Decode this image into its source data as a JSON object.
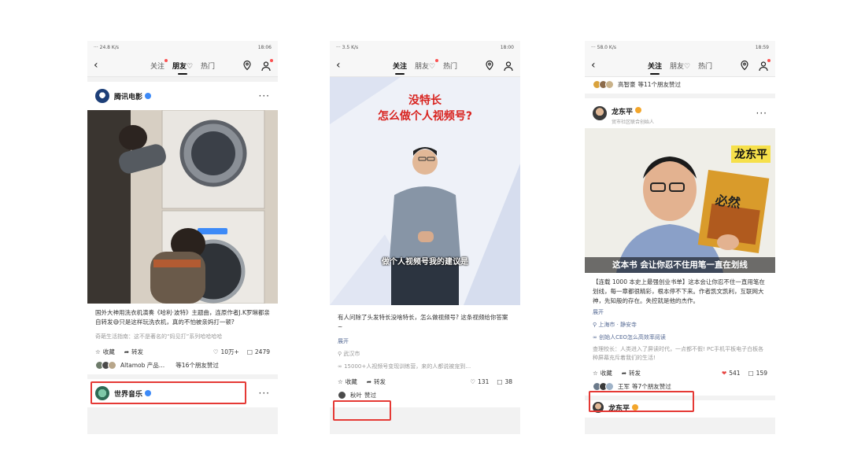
{
  "phones": [
    {
      "status": {
        "left": "··· 24.8 K/s",
        "right": "18:06"
      },
      "tabs": [
        "关注",
        "朋友♡",
        "热门"
      ],
      "active_tab": 1,
      "card": {
        "author": "腾讯电影",
        "text": "国外大神用洗衣机演奏《哈利·波特》主题曲，连原作者J.K罗琳都亲自转发😅只是这样玩洗衣机，真的不怕被亲妈打一顿?",
        "meta": "奇葩生活指南：这不是著名的“妈见打”系列哈哈哈哈",
        "actions": {
          "fav": "收藏",
          "share": "转发",
          "likes": "10万+",
          "comments": "2479"
        },
        "liked_by": {
          "names": "Altamob 产品…",
          "count": "等16个朋友赞过"
        }
      },
      "next_author": "世界音乐"
    },
    {
      "status": {
        "left": "··· 3.5 K/s",
        "right": "18:00"
      },
      "tabs": [
        "关注",
        "朋友♡",
        "热门"
      ],
      "active_tab": 0,
      "card": {
        "video_title_line1": "没特长",
        "video_title_line2": "怎么做个人视频号?",
        "video_caption": "做个人视频号我的建议是",
        "text": "有人问除了头发特长没啥特长，怎么做视频号? 这条视频给你答案~",
        "expand": "展开",
        "location": "武汉市",
        "link": "15000+人视频号变现训练营，来的人都说被宠到…",
        "actions": {
          "fav": "收藏",
          "share": "转发",
          "likes": "131",
          "comments": "38"
        },
        "liked_by": {
          "names": "秋叶",
          "count": "赞过"
        }
      }
    },
    {
      "status": {
        "left": "··· 58.0 K/s",
        "right": "18:59"
      },
      "tabs": [
        "关注",
        "朋友♡",
        "热门"
      ],
      "active_tab": 0,
      "top_liked": {
        "names": "高智豪",
        "count": "等11个朋友赞过"
      },
      "card": {
        "author": "龙东平",
        "author_sub": "贸市社区联合创始人",
        "video_name_tag": "龙东平",
        "book_title": "必然",
        "video_caption": "这本书 会让你忍不住用笔一直在划线",
        "text": "【连载 1000 本史上最强创业书单】这本会让你忍不住一直用笔在划线，每一章都很精彩，根本停不下来。作者凯文凯利，互联网大神，先知般的存在。失控就是他的杰作。",
        "expand": "展开",
        "location": "上海市 · 静安寺",
        "link": "创始人CEO怎么高效率阅读",
        "comment": "查理校长：人类进入了屏读时代，一点都不假! PC手机平板电子白板各种屏幕充斥着我们的生活!",
        "actions": {
          "fav": "收藏",
          "share": "转发",
          "likes": "541",
          "comments": "159"
        },
        "liked_by": {
          "names": "王军",
          "count": "等7个朋友赞过"
        }
      },
      "next_author": "龙东平"
    }
  ],
  "colors": {
    "highlight": "#e53935",
    "link": "#576b95",
    "like_red": "#e64340",
    "verify_blue": "#3d8af7",
    "verify_gold": "#f3a62b"
  }
}
